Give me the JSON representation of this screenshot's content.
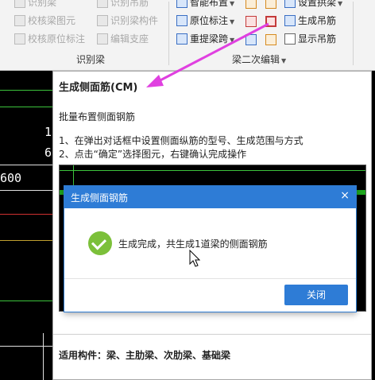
{
  "ribbon": {
    "col1": [
      "识别梁",
      "校核梁图元",
      "校核原位标注"
    ],
    "col2": [
      "识别吊筋",
      "识别梁构件",
      "编辑支座"
    ],
    "group1_label": "识别梁",
    "col3": [
      "智能布置",
      "原位标注",
      "重提梁跨"
    ],
    "col4": [
      "设置拱梁",
      "生成吊筋",
      "显示吊筋"
    ],
    "group2_label": "梁二次编辑"
  },
  "canvas": {
    "num1": "1",
    "num2": "6",
    "num3": "600"
  },
  "tooltip": {
    "title": "生成侧面筋(CM)",
    "subtitle": "批量布置侧面钢筋",
    "step1": "1、在弹出对话框中设置侧面纵筋的型号、生成范围与方式",
    "step2": "2、点击“确定”选择图元，右键确认完成操作",
    "footer": "适用构件：梁、主肋梁、次肋梁、基础梁"
  },
  "dialog": {
    "title": "生成侧面钢筋",
    "close_glyph": "×",
    "message": "生成完成，共生成1道梁的侧面钢筋",
    "button": "关闭"
  },
  "colors": {
    "accent": "#2e7cd6",
    "success": "#7cc03a",
    "arrow": "#e040e0"
  }
}
